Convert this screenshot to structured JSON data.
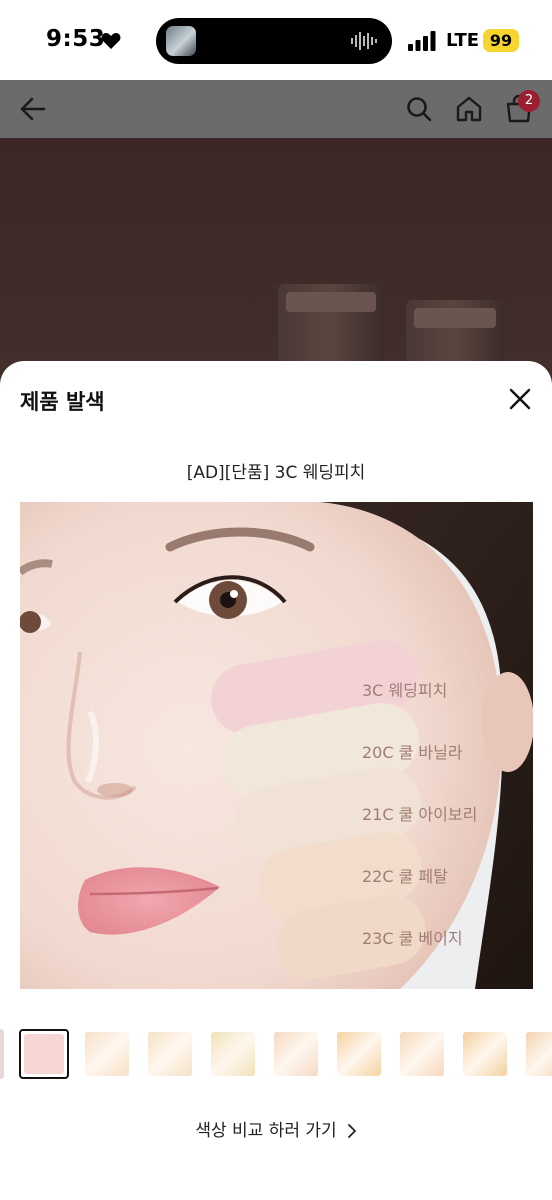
{
  "status_bar": {
    "time": "9:53",
    "network": "LTE",
    "battery": "99",
    "icons": [
      "heart-icon",
      "signal-icon",
      "audio-wave-icon"
    ],
    "colors": {
      "battery": "#f7d531"
    }
  },
  "header": {
    "icons": [
      "back-arrow-icon",
      "search-icon",
      "home-icon",
      "cart-icon"
    ],
    "cart_count": "2",
    "colors": {
      "badge": "#9b1f2f"
    }
  },
  "sheet": {
    "title": "제품 발색",
    "close_icon": "close-icon",
    "product_name": "[AD][단품] 3C 웨딩피치",
    "swatches": [
      {
        "label": "3C 웨딩피치",
        "color": "#f3d2d6"
      },
      {
        "label": "20C 쿨 바닐라",
        "color": "#f1e7da"
      },
      {
        "label": "21C 쿨 아이보리",
        "color": "#f0e3d5"
      },
      {
        "label": "22C 쿨 페탈",
        "color": "#f2ddcd"
      },
      {
        "label": "23C 쿨 베이지",
        "color": "#f0d9c6"
      }
    ],
    "thumbnails": [
      {
        "color": "#f7d5d2",
        "selected": true
      },
      {
        "color": "#f7e0c8",
        "selected": false
      },
      {
        "color": "#f4e2c6",
        "selected": false
      },
      {
        "color": "#f1e2b8",
        "selected": false
      },
      {
        "color": "#f6d9c3",
        "selected": false
      },
      {
        "color": "#f5d39f",
        "selected": false
      },
      {
        "color": "#f6d8bd",
        "selected": false
      },
      {
        "color": "#f3cf9f",
        "selected": false
      },
      {
        "color": "#f2d3b0",
        "selected": false
      }
    ],
    "compare_link": "색상 비교 하러 가기"
  }
}
